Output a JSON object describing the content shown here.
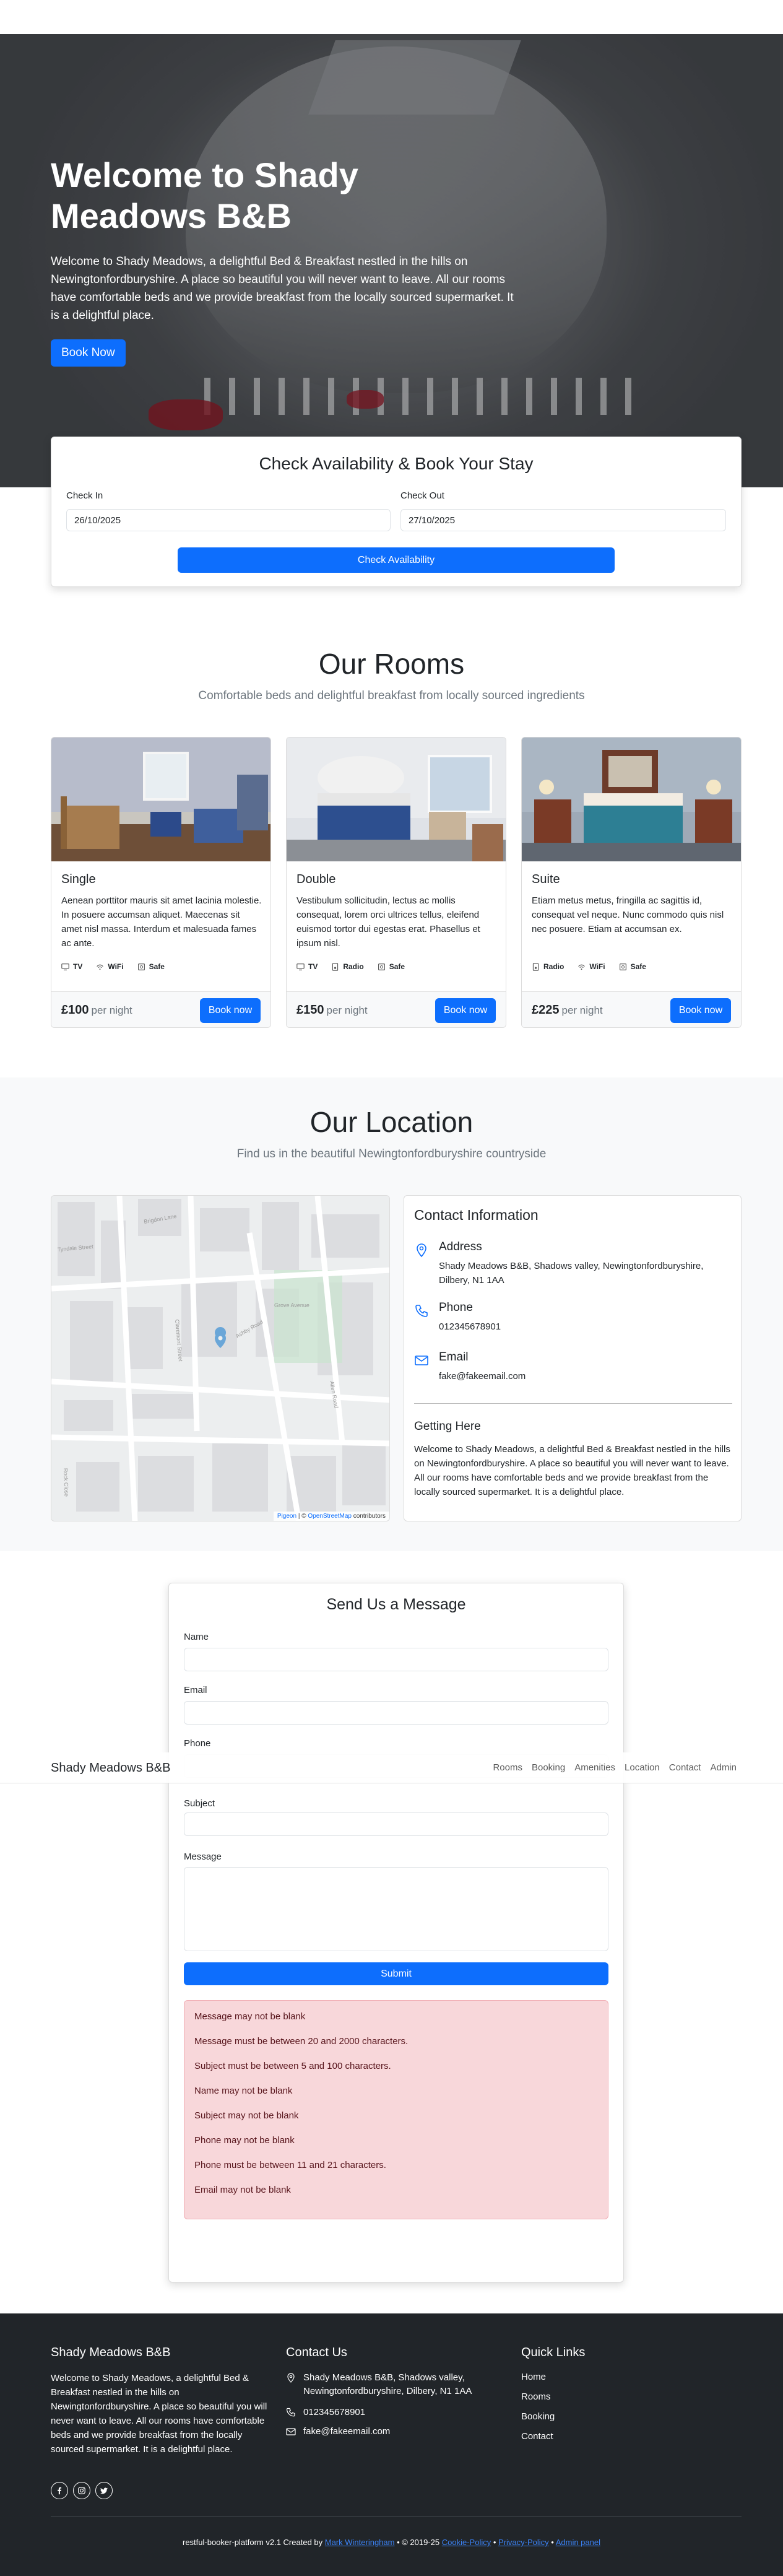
{
  "hero": {
    "title": "Welcome to Shady Meadows B&B",
    "text": "Welcome to Shady Meadows, a delightful Bed & Breakfast nestled in the hills on Newingtonfordburyshire. A place so beautiful you will never want to leave. All our rooms have comfortable beds and we provide breakfast from the locally sourced supermarket. It is a delightful place.",
    "button": "Book Now"
  },
  "booking": {
    "title": "Check Availability & Book Your Stay",
    "checkin_label": "Check In",
    "checkin_value": "26/10/2025",
    "checkout_label": "Check Out",
    "checkout_value": "27/10/2025",
    "button": "Check Availability"
  },
  "rooms": {
    "title": "Our Rooms",
    "subtitle": "Comfortable beds and delightful breakfast from locally sourced ingredients",
    "per_night": "per night",
    "book_label": "Book now",
    "items": [
      {
        "name": "Single",
        "desc": "Aenean porttitor mauris sit amet lacinia molestie. In posuere accumsan aliquet. Maecenas sit amet nisl massa. Interdum et malesuada fames ac ante.",
        "amenities": [
          "TV",
          "WiFi",
          "Safe"
        ],
        "price": "£100"
      },
      {
        "name": "Double",
        "desc": "Vestibulum sollicitudin, lectus ac mollis consequat, lorem orci ultrices tellus, eleifend euismod tortor dui egestas erat. Phasellus et ipsum nisl.",
        "amenities": [
          "TV",
          "Radio",
          "Safe"
        ],
        "price": "£150"
      },
      {
        "name": "Suite",
        "desc": "Etiam metus metus, fringilla ac sagittis id, consequat vel neque. Nunc commodo quis nisl nec posuere. Etiam at accumsan ex.",
        "amenities": [
          "Radio",
          "WiFi",
          "Safe"
        ],
        "price": "£225"
      }
    ]
  },
  "location": {
    "title": "Our Location",
    "subtitle": "Find us in the beautiful Newingtonfordburyshire countryside",
    "map_attribution_pigeon": "Pigeon",
    "map_attribution_sep": " | © ",
    "map_attribution_osm": "OpenStreetMap",
    "map_attribution_tail": " contributors",
    "map_labels": [
      "Brigdon Lane",
      "Tyndale Street",
      "Claremont Street",
      "Ashby Road",
      "Grove Avenue",
      "Allen Road",
      "Rock Close"
    ],
    "contact": {
      "title": "Contact Information",
      "address_label": "Address",
      "address": "Shady Meadows B&B, Shadows valley, Newingtonfordburyshire, Dilbery, N1 1AA",
      "phone_label": "Phone",
      "phone": "012345678901",
      "email_label": "Email",
      "email": "fake@fakeemail.com",
      "getting_here_title": "Getting Here",
      "getting_here": "Welcome to Shady Meadows, a delightful Bed & Breakfast nestled in the hills on Newingtonfordburyshire. A place so beautiful you will never want to leave. All our rooms have comfortable beds and we provide breakfast from the locally sourced supermarket. It is a delightful place."
    }
  },
  "message": {
    "title": "Send Us a Message",
    "name_label": "Name",
    "email_label": "Email",
    "phone_label": "Phone",
    "subject_label": "Subject",
    "message_label": "Message",
    "submit": "Submit",
    "errors": [
      "Message may not be blank",
      "Message must be between 20 and 2000 characters.",
      "Subject must be between 5 and 100 characters.",
      "Name may not be blank",
      "Subject may not be blank",
      "Phone may not be blank",
      "Phone must be between 11 and 21 characters.",
      "Email may not be blank"
    ]
  },
  "navbar": {
    "brand": "Shady Meadows B&B",
    "items": [
      "Rooms",
      "Booking",
      "Amenities",
      "Location",
      "Contact",
      "Admin"
    ]
  },
  "footer": {
    "about_title": "Shady Meadows B&B",
    "about_text": "Welcome to Shady Meadows, a delightful Bed & Breakfast nestled in the hills on Newingtonfordburyshire. A place so beautiful you will never want to leave. All our rooms have comfortable beds and we provide breakfast from the locally sourced supermarket. It is a delightful place.",
    "contact_title": "Contact Us",
    "address": "Shady Meadows B&B, Shadows valley, Newingtonfordburyshire, Dilbery, N1 1AA",
    "phone": "012345678901",
    "email": "fake@fakeemail.com",
    "links_title": "Quick Links",
    "links": [
      "Home",
      "Rooms",
      "Booking",
      "Contact"
    ],
    "copy_prefix": "restful-booker-platform v2.1 Created by ",
    "copy_author": "Mark Winteringham",
    "copy_mid": " • © 2019-25 ",
    "copy_cookie": "Cookie-Policy",
    "copy_sep1": " • ",
    "copy_privacy": "Privacy-Policy",
    "copy_sep2": " • ",
    "copy_admin": "Admin panel"
  },
  "colors": {
    "primary": "#0d6efd",
    "footer_bg": "#212529",
    "error_bg": "#f8d7da",
    "section_bg": "#f8f9fa"
  }
}
